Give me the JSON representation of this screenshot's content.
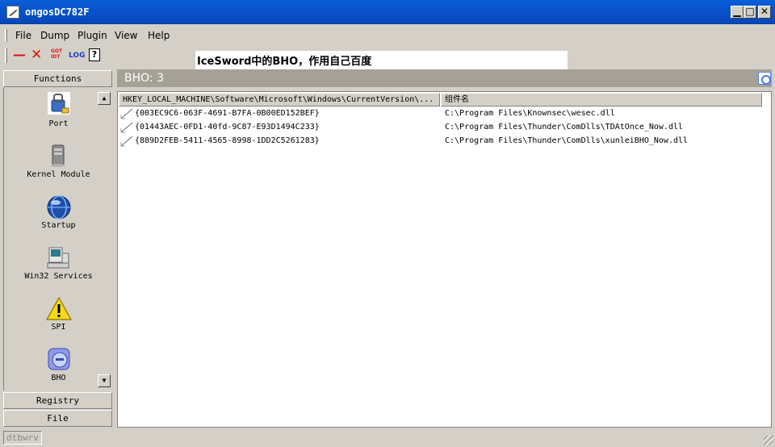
{
  "window": {
    "title": "ongosDC782F",
    "min_glyph": "▁",
    "max_glyph": "□",
    "close_glyph": "✕"
  },
  "menu": {
    "items": [
      {
        "label": "File"
      },
      {
        "label": "Dump"
      },
      {
        "label": "Plugin"
      },
      {
        "label": "View"
      },
      {
        "label": "Help"
      }
    ]
  },
  "toolbar": {
    "dash": "—",
    "close": "✕",
    "got_label": "GOT",
    "idt_label": "IDT",
    "log_label": "LOG",
    "help_label": "?"
  },
  "annotation": {
    "text": "IceSword中的BHO，作用自己百度"
  },
  "leftpanel": {
    "header": "Functions",
    "items": [
      {
        "label": "Port",
        "icon": "port-icon"
      },
      {
        "label": "Kernel Module",
        "icon": "kernel-module-icon"
      },
      {
        "label": "Startup",
        "icon": "startup-icon"
      },
      {
        "label": "Win32 Services",
        "icon": "win32-services-icon"
      },
      {
        "label": "SPI",
        "icon": "warning-icon"
      },
      {
        "label": "BHO",
        "icon": "bho-icon"
      }
    ],
    "registry": "Registry",
    "file": "File",
    "scroll_up": "▲",
    "scroll_down": "▼"
  },
  "main": {
    "title": "BHO: 3",
    "columns": [
      "HKEY_LOCAL_MACHINE\\Software\\Microsoft\\Windows\\CurrentVersion\\...",
      "组件名"
    ],
    "rows": [
      {
        "key": "{003EC9C6-063F-4691-B7FA-0B00ED152BEF}",
        "path": "C:\\Program Files\\Knownsec\\wesec.dll"
      },
      {
        "key": "{01443AEC-0FD1-40fd-9C87-E93D1494C233}",
        "path": "C:\\Program Files\\Thunder\\ComDlls\\TDAtOnce_Now.dll"
      },
      {
        "key": "{889D2FEB-5411-4565-8998-1DD2C5261283}",
        "path": "C:\\Program Files\\Thunder\\ComDlls\\xunleiBHO_Now.dll"
      }
    ]
  },
  "status": {
    "text": "dtbwrv"
  }
}
